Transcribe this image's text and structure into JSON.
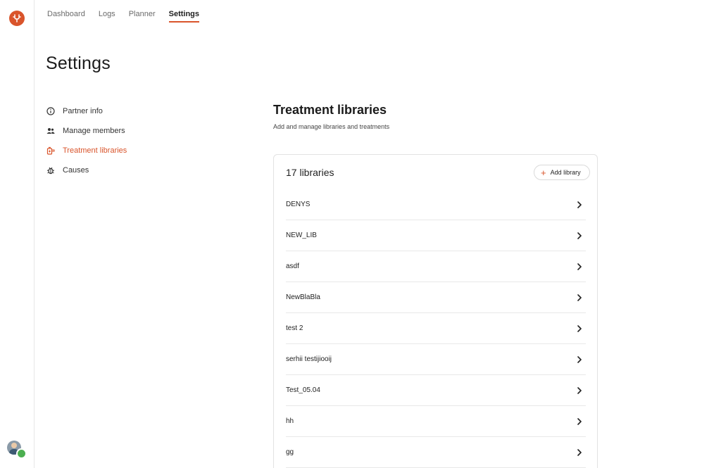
{
  "nav": {
    "tabs": [
      {
        "label": "Dashboard"
      },
      {
        "label": "Logs"
      },
      {
        "label": "Planner"
      },
      {
        "label": "Settings",
        "active": true
      }
    ]
  },
  "page": {
    "title": "Settings"
  },
  "sidebar": {
    "items": [
      {
        "label": "Partner info",
        "icon": "info-icon"
      },
      {
        "label": "Manage members",
        "icon": "members-icon"
      },
      {
        "label": "Treatment libraries",
        "icon": "treatment-icon",
        "active": true
      },
      {
        "label": "Causes",
        "icon": "bug-icon"
      }
    ]
  },
  "section": {
    "title": "Treatment libraries",
    "subtitle": "Add and manage libraries and treatments"
  },
  "card": {
    "count_label": "17 libraries",
    "add_label": "Add library",
    "libraries": [
      "DENYS",
      "NEW_LIB",
      "asdf",
      "NewBlaBla",
      "test 2",
      "serhii testijiooij",
      "Test_05.04",
      "hh",
      "gg"
    ]
  },
  "colors": {
    "accent": "#d9542b",
    "border": "#e2e2e2",
    "text": "#222222"
  }
}
